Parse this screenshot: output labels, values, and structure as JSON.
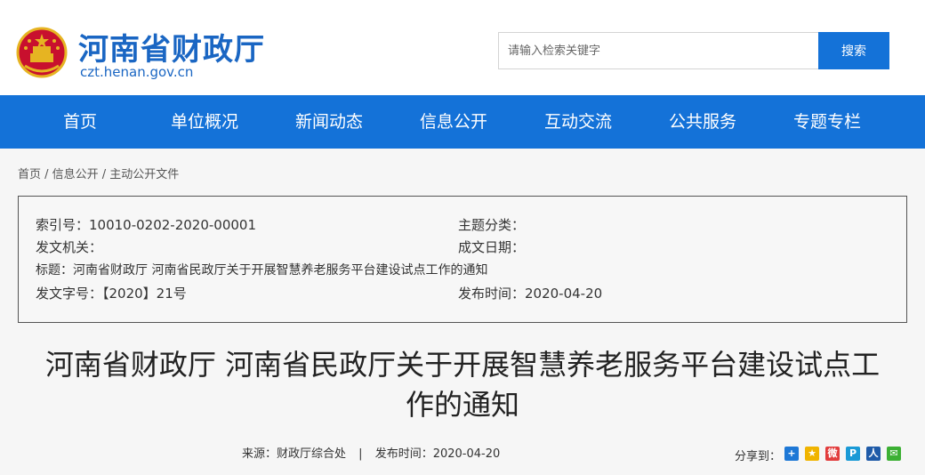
{
  "header": {
    "site_title": "河南省财政厅",
    "site_url": "czt.henan.gov.cn",
    "search_placeholder": "请输入检索关键字",
    "search_button": "搜索"
  },
  "nav": {
    "items": [
      "首页",
      "单位概况",
      "新闻动态",
      "信息公开",
      "互动交流",
      "公共服务",
      "专题专栏"
    ]
  },
  "breadcrumb": "首页 / 信息公开 / 主动公开文件",
  "meta": {
    "index_no": "索引号：10010-0202-2020-00001",
    "subject": "主题分类：",
    "issuer": "发文机关：",
    "created": "成文日期：",
    "title": "标题：河南省财政厅 河南省民政厅关于开展智慧养老服务平台建设试点工作的通知",
    "doc_no": "发文字号：【2020】21号",
    "published": "发布时间：2020-04-20"
  },
  "article": {
    "title_line1": "河南省财政厅 河南省民政厅关于开展智慧养老服务平台建设试点工",
    "title_line2": "作的通知",
    "source": "来源：财政厅综合处",
    "separator": "|",
    "publish_time": "发布时间：2020-04-20",
    "share_label": "分享到："
  },
  "share_icons": [
    {
      "name": "plus-share-icon",
      "color": "#1e78d6",
      "glyph": "+"
    },
    {
      "name": "qzone-icon",
      "color": "#f0b400",
      "glyph": "★"
    },
    {
      "name": "weibo-icon",
      "color": "#e23c3c",
      "glyph": "微"
    },
    {
      "name": "tencent-weibo-icon",
      "color": "#1a9ad6",
      "glyph": "P"
    },
    {
      "name": "renren-icon",
      "color": "#1f5ba8",
      "glyph": "人"
    },
    {
      "name": "wechat-icon",
      "color": "#3cb034",
      "glyph": "✉"
    }
  ],
  "colors": {
    "brand_blue": "#1a66c3",
    "nav_blue": "#1472d8"
  }
}
